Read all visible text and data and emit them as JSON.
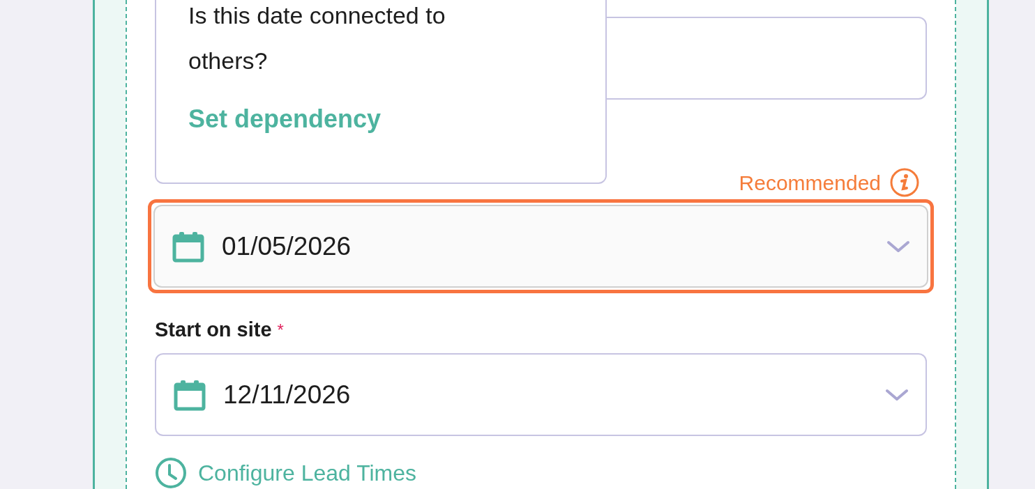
{
  "popover": {
    "question": "Is this date connected to others?",
    "action": "Set dependency"
  },
  "fields": [
    {
      "kind": "blank"
    },
    {
      "kind": "date",
      "value": "01/05/2026",
      "badge": "Recommended",
      "highlighted": true
    },
    {
      "kind": "date",
      "label": "Start on site",
      "required_mark": "*",
      "value": "12/11/2026",
      "highlighted": false
    }
  ],
  "link": "Configure Lead Times"
}
